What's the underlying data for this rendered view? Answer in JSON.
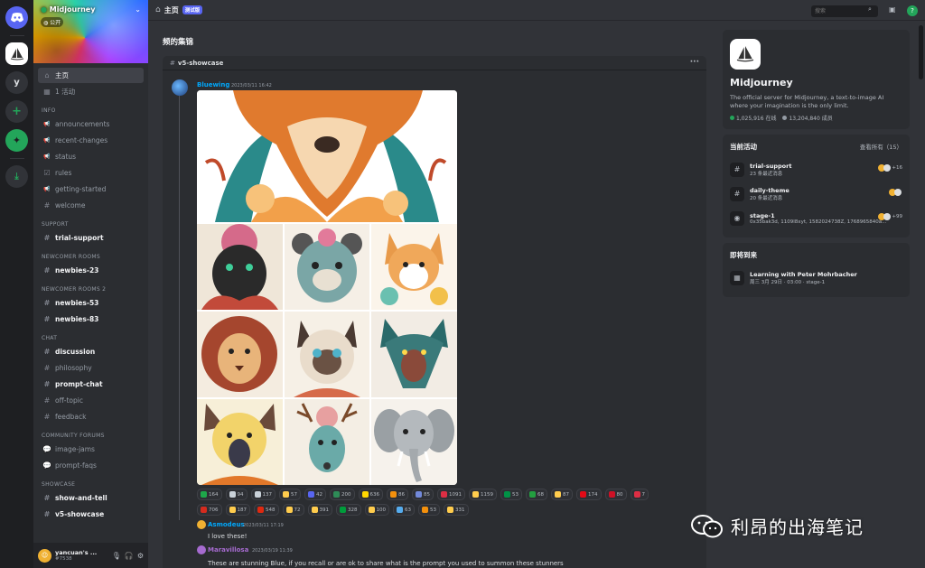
{
  "server": {
    "name": "Midjourney",
    "tag": "公开",
    "rail_letter": "y"
  },
  "sidebar": {
    "top": [
      {
        "icon": "home-icon",
        "label": "主页"
      },
      {
        "icon": "calendar-icon",
        "label": "1 活动"
      }
    ],
    "categories": [
      {
        "name": "INFO",
        "items": [
          {
            "label": "announcements",
            "icon": "megaphone-icon"
          },
          {
            "label": "recent-changes",
            "icon": "megaphone-icon"
          },
          {
            "label": "status",
            "icon": "megaphone-icon"
          },
          {
            "label": "rules",
            "icon": "checkbox-icon"
          },
          {
            "label": "getting-started",
            "icon": "megaphone-icon"
          },
          {
            "label": "welcome",
            "icon": "hash-icon"
          }
        ]
      },
      {
        "name": "SUPPORT",
        "items": [
          {
            "label": "trial-support",
            "icon": "hash-icon",
            "bold": true
          }
        ]
      },
      {
        "name": "NEWCOMER ROOMS",
        "items": [
          {
            "label": "newbies-23",
            "icon": "hash-icon",
            "bold": true
          }
        ]
      },
      {
        "name": "NEWCOMER ROOMS 2",
        "items": [
          {
            "label": "newbies-53",
            "icon": "hash-icon",
            "bold": true
          },
          {
            "label": "newbies-83",
            "icon": "hash-icon",
            "bold": true
          }
        ]
      },
      {
        "name": "CHAT",
        "items": [
          {
            "label": "discussion",
            "icon": "hash-icon",
            "bold": true
          },
          {
            "label": "philosophy",
            "icon": "hash-icon"
          },
          {
            "label": "prompt-chat",
            "icon": "hash-icon",
            "bold": true
          },
          {
            "label": "off-topic",
            "icon": "hash-icon"
          },
          {
            "label": "feedback",
            "icon": "hash-icon"
          }
        ]
      },
      {
        "name": "COMMUNITY FORUMS",
        "items": [
          {
            "label": "image-jams",
            "icon": "forum-icon"
          },
          {
            "label": "prompt-faqs",
            "icon": "forum-icon"
          }
        ]
      },
      {
        "name": "SHOWCASE",
        "items": [
          {
            "label": "show-and-tell",
            "icon": "hash-icon",
            "bold": true
          },
          {
            "label": "v5-showcase",
            "icon": "hash-icon",
            "bold": true
          }
        ]
      }
    ],
    "user": {
      "name": "yancuan's ...",
      "tag": "#7538"
    }
  },
  "topbar": {
    "title": "主页",
    "badge": "测试版",
    "search_placeholder": "搜索"
  },
  "feed": {
    "title": "频的集锦",
    "channel": "v5-showcase",
    "post": {
      "author": "Bluewing",
      "time": "2023/03/11 16:42",
      "author_color": "#00a8fc"
    },
    "reactions_row1": [
      {
        "count": "164",
        "color": "#1ea84a"
      },
      {
        "count": "94",
        "color": "#c9d1d9"
      },
      {
        "count": "137",
        "color": "#c9d1d9"
      },
      {
        "count": "57",
        "color": "#ffcc4d"
      },
      {
        "count": "42",
        "color": "#5865f2"
      },
      {
        "count": "200",
        "color": "#2e8b57"
      },
      {
        "count": "636",
        "color": "#ffd700"
      },
      {
        "count": "86",
        "color": "#f4900c"
      },
      {
        "count": "85",
        "color": "#7289da"
      },
      {
        "count": "1091",
        "color": "#dd2e44"
      },
      {
        "count": "1159",
        "color": "#ffcc4d"
      },
      {
        "count": "53",
        "color": "#009246"
      },
      {
        "count": "68",
        "color": "#239f40"
      },
      {
        "count": "87",
        "color": "#ffcc4d"
      },
      {
        "count": "174",
        "color": "#e30a17"
      },
      {
        "count": "80",
        "color": "#ce1126"
      },
      {
        "count": "7",
        "color": "#dd2e44"
      }
    ],
    "reactions_row2": [
      {
        "count": "706",
        "color": "#d52b1e"
      },
      {
        "count": "187",
        "color": "#ffcc4d"
      },
      {
        "count": "548",
        "color": "#de2910"
      },
      {
        "count": "72",
        "color": "#ffcc4d"
      },
      {
        "count": "391",
        "color": "#ffcc4d"
      },
      {
        "count": "328",
        "color": "#009c3b"
      },
      {
        "count": "100",
        "color": "#ffcc4d"
      },
      {
        "count": "63",
        "color": "#55acee"
      },
      {
        "count": "53",
        "color": "#f4900c"
      },
      {
        "count": "331",
        "color": "#ffcc4d"
      }
    ],
    "reply1": {
      "author": "Asmodeus",
      "time": "2023/03/11 17:19",
      "text": "I love these!",
      "author_color": "#00a8fc"
    },
    "reply2": {
      "author": "Maravillosa",
      "time": "2023/03/19 11:39",
      "text": "These are stunning Blue, if you recall or are ok to share what is the prompt you used to summon these stunners",
      "author_color": "#a66bd0"
    }
  },
  "right": {
    "server_title": "Midjourney",
    "server_desc": "The official server for Midjourney, a text-to-image AI where your imagination is the only limit.",
    "online": "1,025,916 在线",
    "members": "13,204,840 成员",
    "activity_title": "当前活动",
    "activity_link": "查看所有（15）",
    "activities": [
      {
        "name": "trial-support",
        "sub": "23 条最近消息",
        "badge": "+16",
        "icon": "hash-icon"
      },
      {
        "name": "daily-theme",
        "sub": "20 条最近消息",
        "badge": "",
        "icon": "hash-icon"
      },
      {
        "name": "stage-1",
        "sub": "0x35bak3d, 1109l8xyt, 1582024738Z, 1768965840a...",
        "badge": "+99",
        "icon": "stage-icon"
      }
    ],
    "events_title": "即将到来",
    "event": {
      "name": "Learning with Peter Mohrbacher",
      "sub": "周三 3月 29日 · 03:00 · stage-1"
    }
  },
  "watermark": {
    "text": "利昂的出海笔记"
  }
}
